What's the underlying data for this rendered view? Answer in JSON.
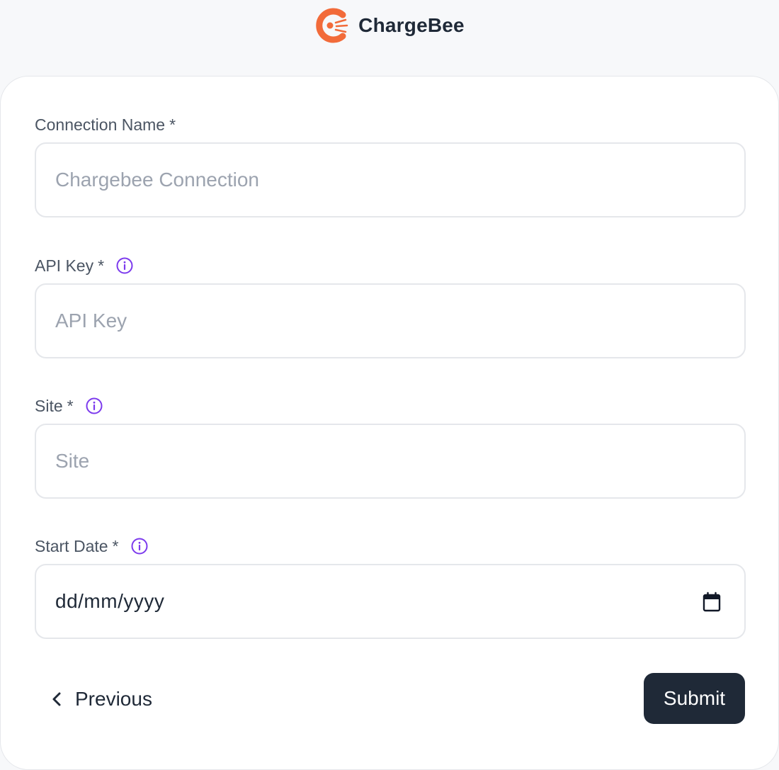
{
  "brand": {
    "name": "ChargeBee",
    "logo_icon": "chargebee-logo",
    "logo_color": "#f26b3a"
  },
  "form": {
    "required_marker": "*",
    "accent_color": "#7c3aed",
    "connection_name": {
      "label": "Connection Name",
      "placeholder": "Chargebee Connection",
      "value": ""
    },
    "api_key": {
      "label": "API Key",
      "placeholder": "API Key",
      "value": "",
      "info_icon": "info-icon"
    },
    "site": {
      "label": "Site",
      "placeholder": "Site",
      "value": "",
      "info_icon": "info-icon"
    },
    "start_date": {
      "label": "Start Date",
      "value": "dd/mm/yyyy",
      "info_icon": "info-icon",
      "picker_icon": "calendar-icon"
    }
  },
  "actions": {
    "previous_label": "Previous",
    "previous_icon": "chevron-left-icon",
    "submit_label": "Submit"
  }
}
